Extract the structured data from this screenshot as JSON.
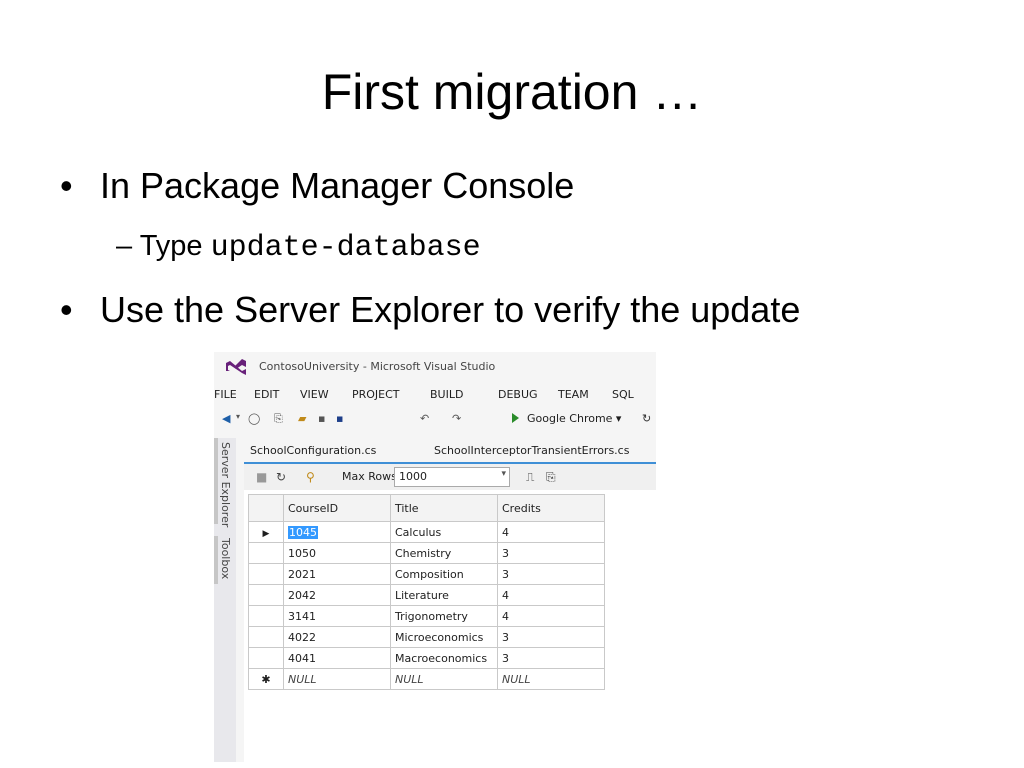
{
  "slide": {
    "title": "First migration …",
    "bullets": [
      {
        "text": "In Package Manager Console"
      },
      {
        "text": "Use the Server Explorer to verify the update"
      }
    ],
    "bullet_glyph": "•",
    "sub_bullet": {
      "dash": "–",
      "prefix": "Type",
      "code": "update-database"
    }
  },
  "vs": {
    "window_title": "ContosoUniversity - Microsoft Visual Studio",
    "menu": [
      "FILE",
      "EDIT",
      "VIEW",
      "PROJECT",
      "BUILD",
      "DEBUG",
      "TEAM",
      "SQL"
    ],
    "run_target": "Google Chrome",
    "side_tabs": [
      "Server Explorer",
      "Toolbox"
    ],
    "doc_tabs": [
      "SchoolConfiguration.cs",
      "SchoolInterceptorTransientErrors.cs"
    ],
    "max_rows_label": "Max Rows:",
    "max_rows_value": "1000",
    "accent_color": "#3f8fd6",
    "columns": [
      "CourseID",
      "Title",
      "Credits"
    ],
    "rows": [
      [
        "1045",
        "Calculus",
        "4"
      ],
      [
        "1050",
        "Chemistry",
        "3"
      ],
      [
        "2021",
        "Composition",
        "3"
      ],
      [
        "2042",
        "Literature",
        "4"
      ],
      [
        "3141",
        "Trigonometry",
        "4"
      ],
      [
        "4022",
        "Microeconomics",
        "3"
      ],
      [
        "4041",
        "Macroeconomics",
        "3"
      ]
    ],
    "new_row": [
      "NULL",
      "NULL",
      "NULL"
    ],
    "current_row_marker": "▶",
    "new_row_marker": "✱"
  }
}
